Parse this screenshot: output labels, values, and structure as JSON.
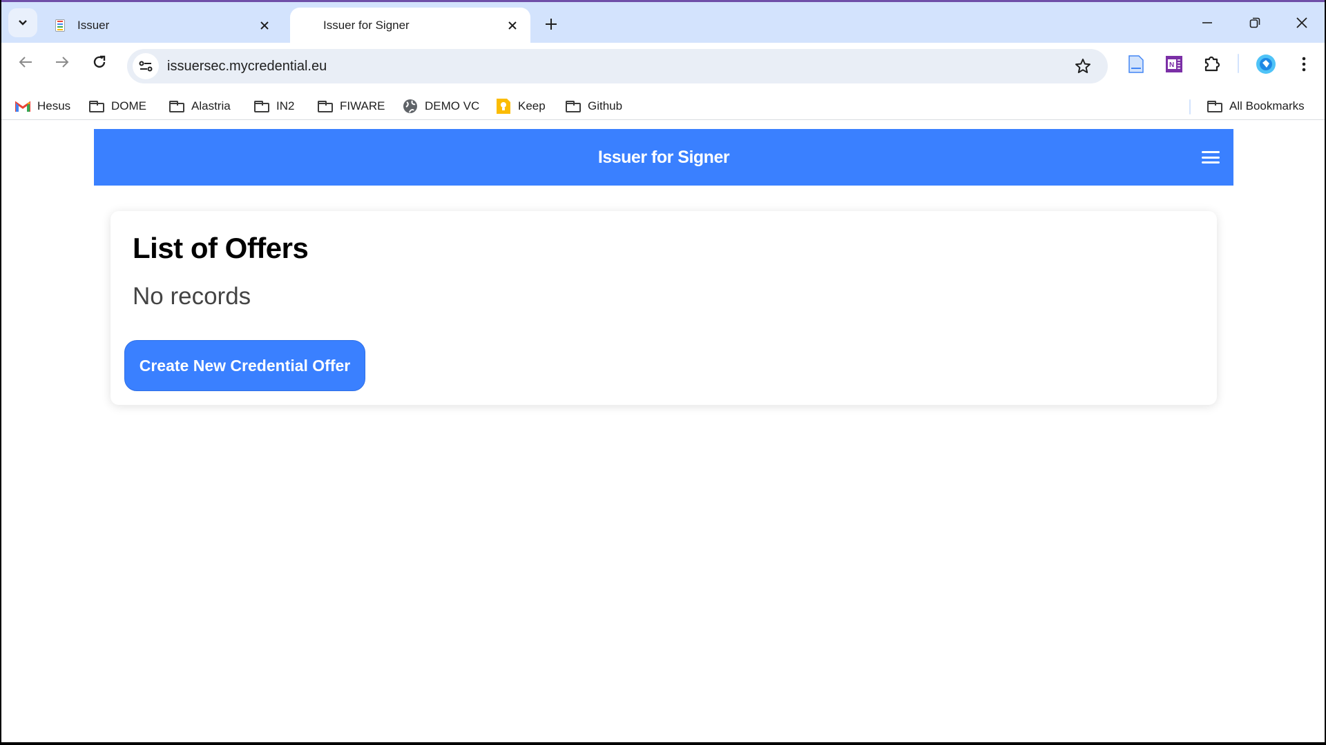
{
  "browser": {
    "tabs": [
      {
        "title": "Issuer",
        "active": false
      },
      {
        "title": "Issuer for Signer",
        "active": true
      }
    ],
    "url": "issuersec.mycredential.eu",
    "bookmarks": [
      {
        "label": "Hesus",
        "icon": "gmail-icon"
      },
      {
        "label": "DOME",
        "icon": "folder-icon"
      },
      {
        "label": "Alastria",
        "icon": "folder-icon"
      },
      {
        "label": "IN2",
        "icon": "folder-icon"
      },
      {
        "label": "FIWARE",
        "icon": "folder-icon"
      },
      {
        "label": "DEMO VC",
        "icon": "globe-icon"
      },
      {
        "label": "Keep",
        "icon": "keep-icon"
      },
      {
        "label": "Github",
        "icon": "folder-icon"
      }
    ],
    "all_bookmarks_label": "All Bookmarks"
  },
  "app": {
    "title": "Issuer for Signer",
    "accent_color": "#3a80ff"
  },
  "offers": {
    "heading": "List of Offers",
    "empty_text": "No records",
    "create_button_label": "Create New Credential Offer"
  }
}
